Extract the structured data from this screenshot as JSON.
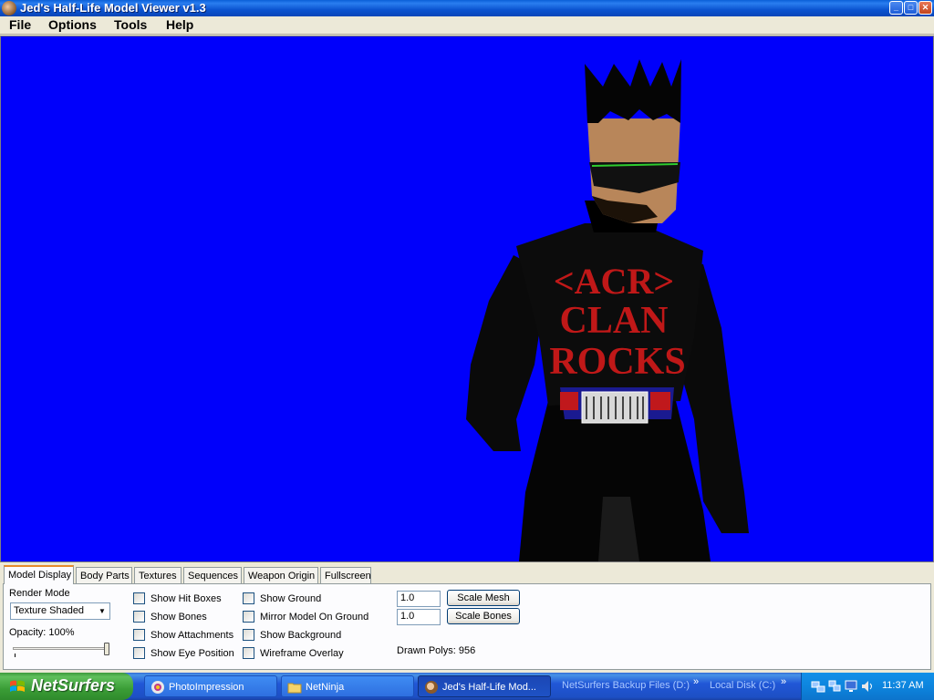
{
  "window": {
    "title": "Jed's Half-Life Model Viewer v1.3",
    "caption_buttons": {
      "minimize": "_",
      "maximize": "□",
      "close": "✕"
    }
  },
  "menu": [
    "File",
    "Options",
    "Tools",
    "Help"
  ],
  "viewport": {
    "background_color": "#0000fb",
    "model_shirt_text": [
      "<ACR>",
      "CLAN",
      "ROCKS"
    ]
  },
  "tabs": [
    "Model Display",
    "Body Parts",
    "Textures",
    "Sequences",
    "Weapon Origin",
    "Fullscreen"
  ],
  "active_tab": "Model Display",
  "panel": {
    "render_mode_label": "Render Mode",
    "render_mode_value": "Texture Shaded",
    "opacity_label": "Opacity: 100%",
    "opacity_value": 1.0,
    "checkboxes_col1": [
      "Show Hit Boxes",
      "Show Bones",
      "Show Attachments",
      "Show Eye Position"
    ],
    "checkboxes_col2": [
      "Show Ground",
      "Mirror Model On Ground",
      "Show Background",
      "Wireframe Overlay"
    ],
    "scale_mesh_value": "1.0",
    "scale_bones_value": "1.0",
    "scale_mesh_button": "Scale Mesh",
    "scale_bones_button": "Scale Bones",
    "drawn_polys": "Drawn Polys: 956"
  },
  "taskbar": {
    "start_label": "NetSurfers",
    "tasks": [
      "PhotoImpression",
      "NetNinja",
      "Jed's Half-Life Mod..."
    ],
    "toolbars": [
      "NetSurfers Backup Files (D:)",
      "Local Disk (C:)"
    ],
    "chevron": "»",
    "clock": "11:37 AM"
  }
}
